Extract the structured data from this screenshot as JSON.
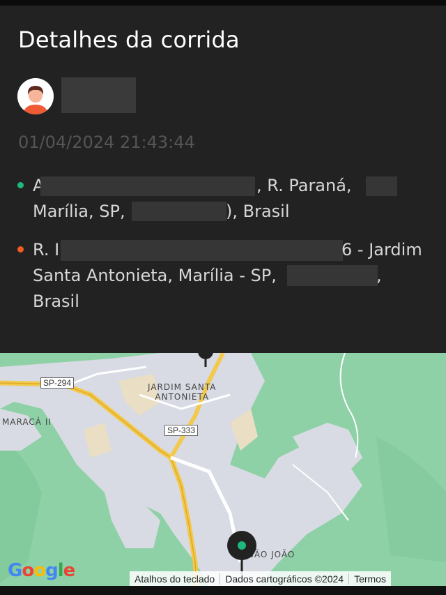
{
  "sheet": {
    "title": "Detalhes da corrida",
    "datetime": "01/04/2024 21:43:44"
  },
  "origin": {
    "line1_start": "A",
    "line1_end": ", R. Paraná,",
    "line2_start": "Marília, SP,",
    "line2_end": "), Brasil",
    "dot_color": "#1fb87c"
  },
  "destination": {
    "line1_start": "R. I",
    "line1_end": "6 - Jardim",
    "line2": "Santa Antonieta, Marília - SP,",
    "line2_end": ",",
    "line3": "Brasil",
    "dot_color": "#f15a24"
  },
  "map": {
    "labels": {
      "sp294": "SP-294",
      "sp333": "SP-333",
      "jardim1": "JARDIM SANTA",
      "jardim2": "ANTONIETA",
      "maraca": "MARACÁ II",
      "saojoao": "SÃO JOÃO"
    },
    "attribution": {
      "shortcuts": "Atalhos do teclado",
      "mapdata": "Dados cartográficos ©2024",
      "terms": "Termos"
    },
    "logo": "Google"
  }
}
